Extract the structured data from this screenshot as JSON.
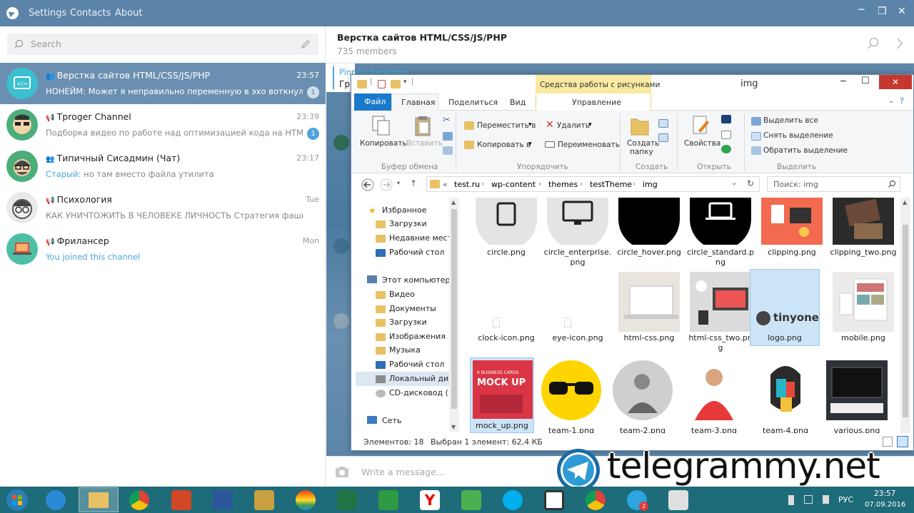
{
  "telegram": {
    "menu": [
      "Settings",
      "Contacts",
      "About"
    ],
    "search_placeholder": "Search",
    "chats": [
      {
        "name": "Верстка сайтов HTML/CSS/JS/PHP",
        "time": "23:57",
        "message": "НОНЕЙМ: Может я неправильно переменную в эхо воткнул?",
        "badge": "1",
        "type": "group",
        "selected": true
      },
      {
        "name": "Tproger Channel",
        "time": "23:39",
        "message": "Подборка видео по работе над оптимизацией кода на HTM...",
        "badge": "1",
        "type": "channel",
        "selected": false
      },
      {
        "name": "Типичный Сисадмин (Чат)",
        "time": "23:17",
        "sender": "Старый:",
        "message": " но там вместо файла утилита",
        "badge": "",
        "type": "group",
        "selected": false
      },
      {
        "name": "Психология",
        "time": "Tue",
        "message": "КАК УНИЧТОЖИТЬ В ЧЕЛОВЕКЕ ЛИЧНОСТЬ  Стратегия фашистс...",
        "badge": "",
        "type": "channel",
        "selected": false
      },
      {
        "name": "Фрилансер",
        "time": "Mon",
        "message": "You joined this channel",
        "badge": "",
        "type": "channel",
        "selected": false
      }
    ],
    "header": {
      "title": "Верстка сайтов HTML/CSS/JS/PHP",
      "subtitle": "735 members"
    },
    "pinned": {
      "label": "Pinned message",
      "preview": "Гр"
    },
    "composer_placeholder": "Write a message..."
  },
  "explorer": {
    "title": "img",
    "context_tab": "Средства работы с рисунками",
    "tabs": [
      "Файл",
      "Главная",
      "Поделиться",
      "Вид",
      "Управление"
    ],
    "ribbon": {
      "clipboard": {
        "copy": "Копировать",
        "paste": "Вставить",
        "group": "Буфер обмена"
      },
      "organize": {
        "move": "Переместить в",
        "copy_to": "Копировать в",
        "delete": "Удалить",
        "rename": "Переименовать",
        "group": "Упорядочить"
      },
      "create": {
        "new_folder": "Создать папку",
        "new_folder_l1": "Создать",
        "new_folder_l2": "папку",
        "group": "Создать"
      },
      "open": {
        "props": "Свойства",
        "group": "Открыть"
      },
      "select": {
        "all": "Выделить все",
        "none": "Снять выделение",
        "invert": "Обратить выделение",
        "group": "Выделить"
      }
    },
    "breadcrumb": [
      "«",
      "test.ru",
      "wp-content",
      "themes",
      "testTheme",
      "img"
    ],
    "search_placeholder": "Поиск: img",
    "nav": {
      "favorites": "Избранное",
      "fav_items": [
        "Загрузки",
        "Недавние места",
        "Рабочий стол"
      ],
      "computer": "Этот компьютер",
      "pc_items": [
        "Видео",
        "Документы",
        "Загрузки",
        "Изображения",
        "Музыка",
        "Рабочий стол",
        "Локальный диск",
        "CD-дисковод (F:)"
      ],
      "network": "Сеть"
    },
    "files": [
      {
        "name": "circle.png",
        "icon": "tablet-icon"
      },
      {
        "name": "circle_enterprise.png",
        "l1": "circle_enterprise.",
        "l2": "png",
        "icon": "monitor-icon"
      },
      {
        "name": "circle_hover.png",
        "icon": "black-circle"
      },
      {
        "name": "circle_standard.png",
        "l1": "circle_standard.p",
        "l2": "ng",
        "icon": "laptop-icon"
      },
      {
        "name": "clipping.png",
        "icon": "red-photo"
      },
      {
        "name": "clipping_two.png",
        "icon": "dark-photo"
      },
      {
        "name": "clock-icon.png",
        "icon": "blank"
      },
      {
        "name": "eye-icon.png",
        "icon": "blank"
      },
      {
        "name": "html-css.png",
        "icon": "laptop-photo"
      },
      {
        "name": "html-css_two.png",
        "l1": "html-css_two.pn",
        "l2": "g",
        "icon": "desk-photo"
      },
      {
        "name": "logo.png",
        "icon": "logo",
        "logo_text": "tinyone"
      },
      {
        "name": "mobile.png",
        "icon": "devices-photo"
      },
      {
        "name": "mock_up.png",
        "icon": "mockup",
        "mock_small": "6 BUSINESS CARDS",
        "mock_big": "MOCK UP"
      },
      {
        "name": "team-1.png",
        "icon": "glasses"
      },
      {
        "name": "team-2.png",
        "icon": "person-bw"
      },
      {
        "name": "team-3.png",
        "icon": "person-red"
      },
      {
        "name": "team-4.png",
        "icon": "person-art"
      },
      {
        "name": "various.png",
        "icon": "various-photo"
      }
    ],
    "status_count": "Элементов: 18",
    "status_selected": "Выбран 1 элемент: 62,4 КБ"
  },
  "taskbar": {
    "lang": "РУС",
    "time": "23:57",
    "date": "07.09.2016",
    "notif": "2"
  },
  "watermark": "telegrammy.net",
  "colors": {
    "accent": "#5b84a8",
    "badge": "#4ea4dc",
    "file_tab": "#1979ca",
    "context": "#f8eaa0"
  }
}
